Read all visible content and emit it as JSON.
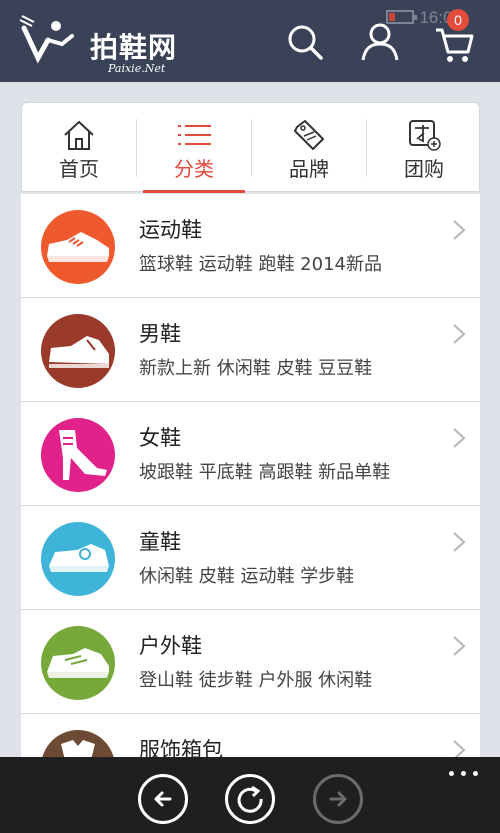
{
  "header": {
    "logo_text": "拍鞋网",
    "logo_sub": "Paixie.Net",
    "time": "16:03",
    "cart_badge": "0",
    "background": "#3a4257"
  },
  "tabs": [
    {
      "label": "首页",
      "icon": "home-icon",
      "active": false
    },
    {
      "label": "分类",
      "icon": "list-icon",
      "active": true
    },
    {
      "label": "品牌",
      "icon": "tag-icon",
      "active": false
    },
    {
      "label": "团购",
      "icon": "group-buy-icon",
      "active": false
    }
  ],
  "categories": [
    {
      "name": "运动鞋",
      "tags": "篮球鞋 运动鞋 跑鞋 2014新品",
      "icon": "sneaker-icon",
      "color": "#ee5a2e"
    },
    {
      "name": "男鞋",
      "tags": "新款上新 休闲鞋 皮鞋 豆豆鞋",
      "icon": "mens-shoe-icon",
      "color": "#9a3a2a"
    },
    {
      "name": "女鞋",
      "tags": "坡跟鞋 平底鞋 高跟鞋 新品单鞋",
      "icon": "high-heel-icon",
      "color": "#e0228a"
    },
    {
      "name": "童鞋",
      "tags": "休闲鞋 皮鞋 运动鞋 学步鞋",
      "icon": "kids-shoe-icon",
      "color": "#3db4d8"
    },
    {
      "name": "户外鞋",
      "tags": "登山鞋 徒步鞋 户外服 休闲鞋",
      "icon": "hiking-shoe-icon",
      "color": "#76a83a"
    },
    {
      "name": "服饰箱包",
      "tags": "",
      "icon": "apparel-bag-icon",
      "color": "#6d4a33"
    }
  ],
  "accent": "#e24a3b"
}
